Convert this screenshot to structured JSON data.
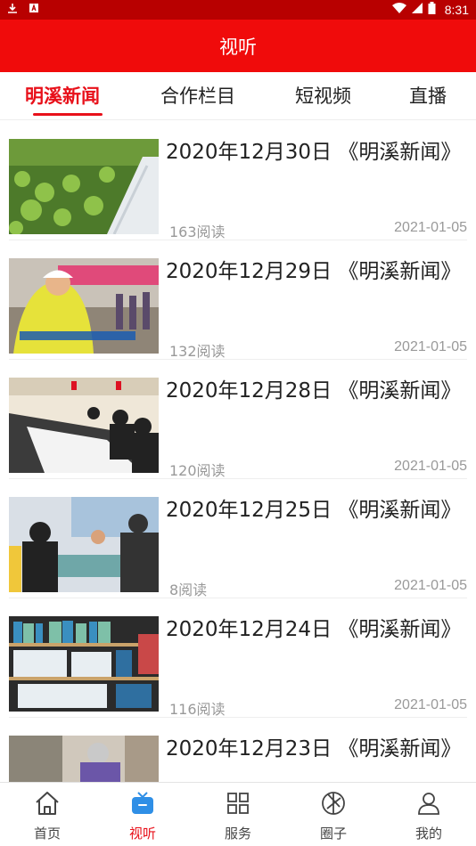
{
  "status_bar": {
    "time": "8:31"
  },
  "header": {
    "title": "视听"
  },
  "tabs": [
    {
      "label": "明溪新闻",
      "active": true
    },
    {
      "label": "合作栏目",
      "active": false
    },
    {
      "label": "短视频",
      "active": false
    },
    {
      "label": "直播",
      "active": false
    }
  ],
  "news": [
    {
      "title": "2020年12月30日 《明溪新闻》",
      "reads": "163阅读",
      "date": "2021-01-05",
      "thumb": "field-icon"
    },
    {
      "title": "2020年12月29日 《明溪新闻》",
      "reads": "132阅读",
      "date": "2021-01-05",
      "thumb": "cycling-icon"
    },
    {
      "title": "2020年12月28日 《明溪新闻》",
      "reads": "120阅读",
      "date": "2021-01-05",
      "thumb": "meeting-icon"
    },
    {
      "title": "2020年12月25日 《明溪新闻》",
      "reads": "8阅读",
      "date": "2021-01-05",
      "thumb": "discussion-icon"
    },
    {
      "title": "2020年12月24日 《明溪新闻》",
      "reads": "116阅读",
      "date": "2021-01-05",
      "thumb": "bookshelf-icon"
    },
    {
      "title": "2020年12月23日 《明溪新闻》",
      "reads": "",
      "date": "",
      "thumb": "elderly-icon"
    }
  ],
  "bottom_nav": [
    {
      "label": "首页",
      "icon": "home-icon",
      "active": false
    },
    {
      "label": "视听",
      "icon": "tv-icon",
      "active": true
    },
    {
      "label": "服务",
      "icon": "grid-icon",
      "active": false
    },
    {
      "label": "圈子",
      "icon": "aperture-icon",
      "active": false
    },
    {
      "label": "我的",
      "icon": "person-icon",
      "active": false
    }
  ],
  "colors": {
    "brand_red": "#f00b0b",
    "accent_red": "#e8101a",
    "status_bar": "#b80000",
    "muted_text": "#999999"
  }
}
